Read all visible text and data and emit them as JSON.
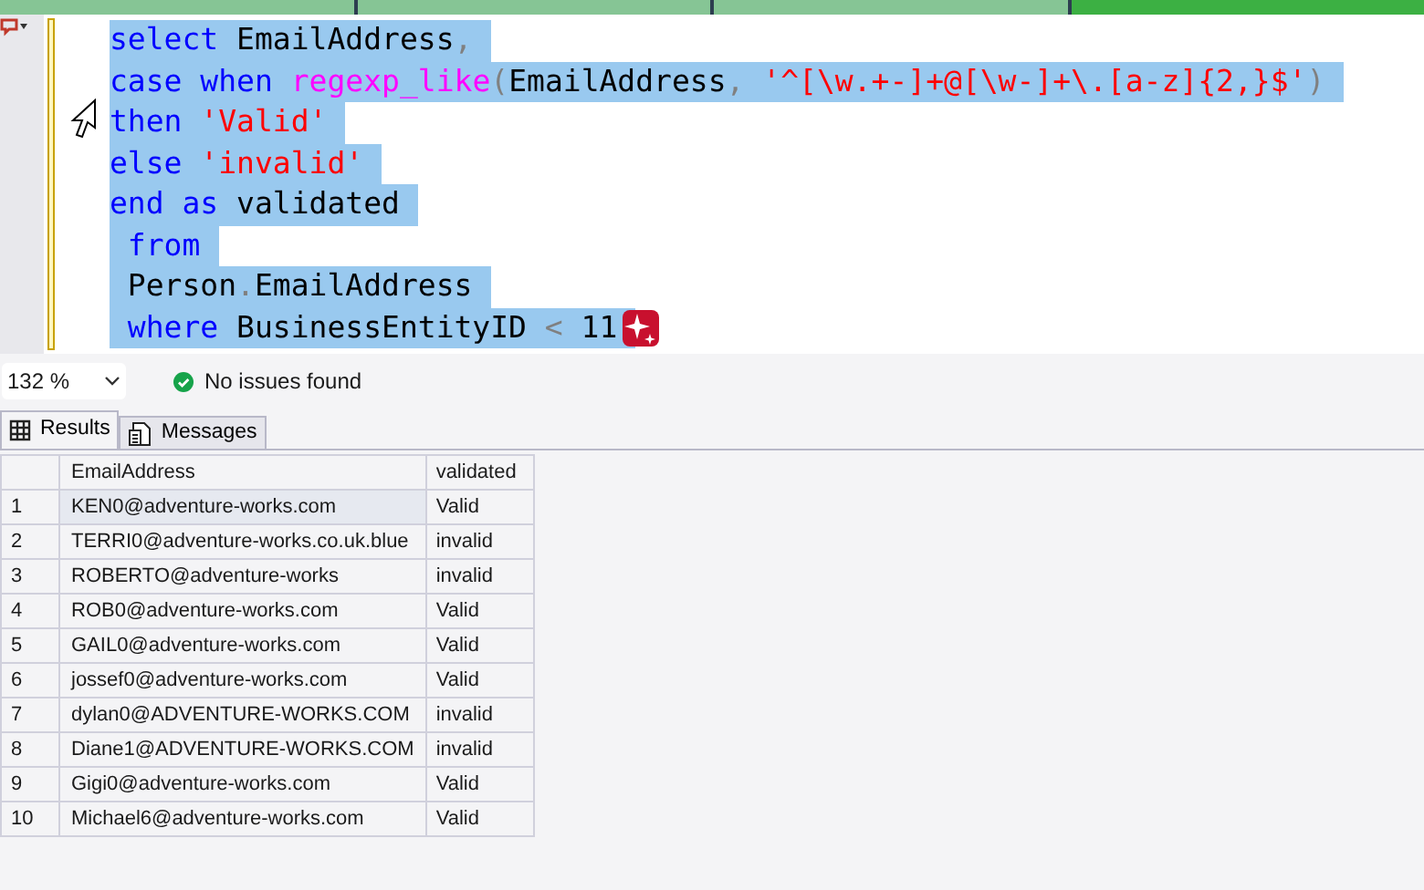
{
  "document_tabs": [
    {
      "selected": false
    },
    {
      "selected": false
    },
    {
      "selected": false
    },
    {
      "selected": true
    }
  ],
  "editor": {
    "lines": [
      [
        {
          "kind": "keyword",
          "text": "select"
        },
        {
          "kind": "plain",
          "text": " EmailAddress"
        },
        {
          "kind": "operator",
          "text": ","
        }
      ],
      [
        {
          "kind": "keyword",
          "text": "case"
        },
        {
          "kind": "keyword",
          "text": " when"
        },
        {
          "kind": "function",
          "text": " regexp_like"
        },
        {
          "kind": "operator",
          "text": "("
        },
        {
          "kind": "plain",
          "text": "EmailAddress"
        },
        {
          "kind": "operator",
          "text": ","
        },
        {
          "kind": "string",
          "text": " '^[\\w.+-]+@[\\w-]+\\.[a-z]{2,}$'"
        },
        {
          "kind": "operator",
          "text": ")"
        }
      ],
      [
        {
          "kind": "keyword",
          "text": "then"
        },
        {
          "kind": "string",
          "text": " 'Valid'"
        }
      ],
      [
        {
          "kind": "keyword",
          "text": "else"
        },
        {
          "kind": "string",
          "text": " 'invalid'"
        }
      ],
      [
        {
          "kind": "keyword",
          "text": "end"
        },
        {
          "kind": "keyword",
          "text": " as"
        },
        {
          "kind": "plain",
          "text": " validated"
        }
      ],
      [
        {
          "kind": "keyword",
          "text": " from"
        }
      ],
      [
        {
          "kind": "plain",
          "text": " Person"
        },
        {
          "kind": "operator",
          "text": "."
        },
        {
          "kind": "plain",
          "text": "EmailAddress"
        }
      ],
      [
        {
          "kind": "keyword",
          "text": " where"
        },
        {
          "kind": "plain",
          "text": " BusinessEntityID "
        },
        {
          "kind": "operator",
          "text": "<"
        },
        {
          "kind": "plain",
          "text": " 11"
        }
      ]
    ]
  },
  "status_bar": {
    "zoom": "132 %",
    "message": "No issues found"
  },
  "result_tabs": [
    {
      "label": "Results",
      "selected": true
    },
    {
      "label": "Messages",
      "selected": false
    }
  ],
  "table": {
    "columns": [
      "EmailAddress",
      "validated"
    ],
    "rows": [
      {
        "number": "1",
        "email": "KEN0@adventure-works.com",
        "validated": "Valid",
        "focused": true
      },
      {
        "number": "2",
        "email": "TERRI0@adventure-works.co.uk.blue",
        "validated": "invalid",
        "focused": false
      },
      {
        "number": "3",
        "email": "ROBERTO@adventure-works",
        "validated": "invalid",
        "focused": false
      },
      {
        "number": "4",
        "email": "ROB0@adventure-works.com",
        "validated": "Valid",
        "focused": false
      },
      {
        "number": "5",
        "email": "GAIL0@adventure-works.com",
        "validated": "Valid",
        "focused": false
      },
      {
        "number": "6",
        "email": "jossef0@adventure-works.com",
        "validated": "Valid",
        "focused": false
      },
      {
        "number": "7",
        "email": "dylan0@ADVENTURE-WORKS.COM",
        "validated": "invalid",
        "focused": false
      },
      {
        "number": "8",
        "email": "Diane1@ADVENTURE-WORKS.COM",
        "validated": "invalid",
        "focused": false
      },
      {
        "number": "9",
        "email": "Gigi0@adventure-works.com",
        "validated": "Valid",
        "focused": false
      },
      {
        "number": "10",
        "email": "Michael6@adventure-works.com",
        "validated": "Valid",
        "focused": false
      }
    ]
  }
}
